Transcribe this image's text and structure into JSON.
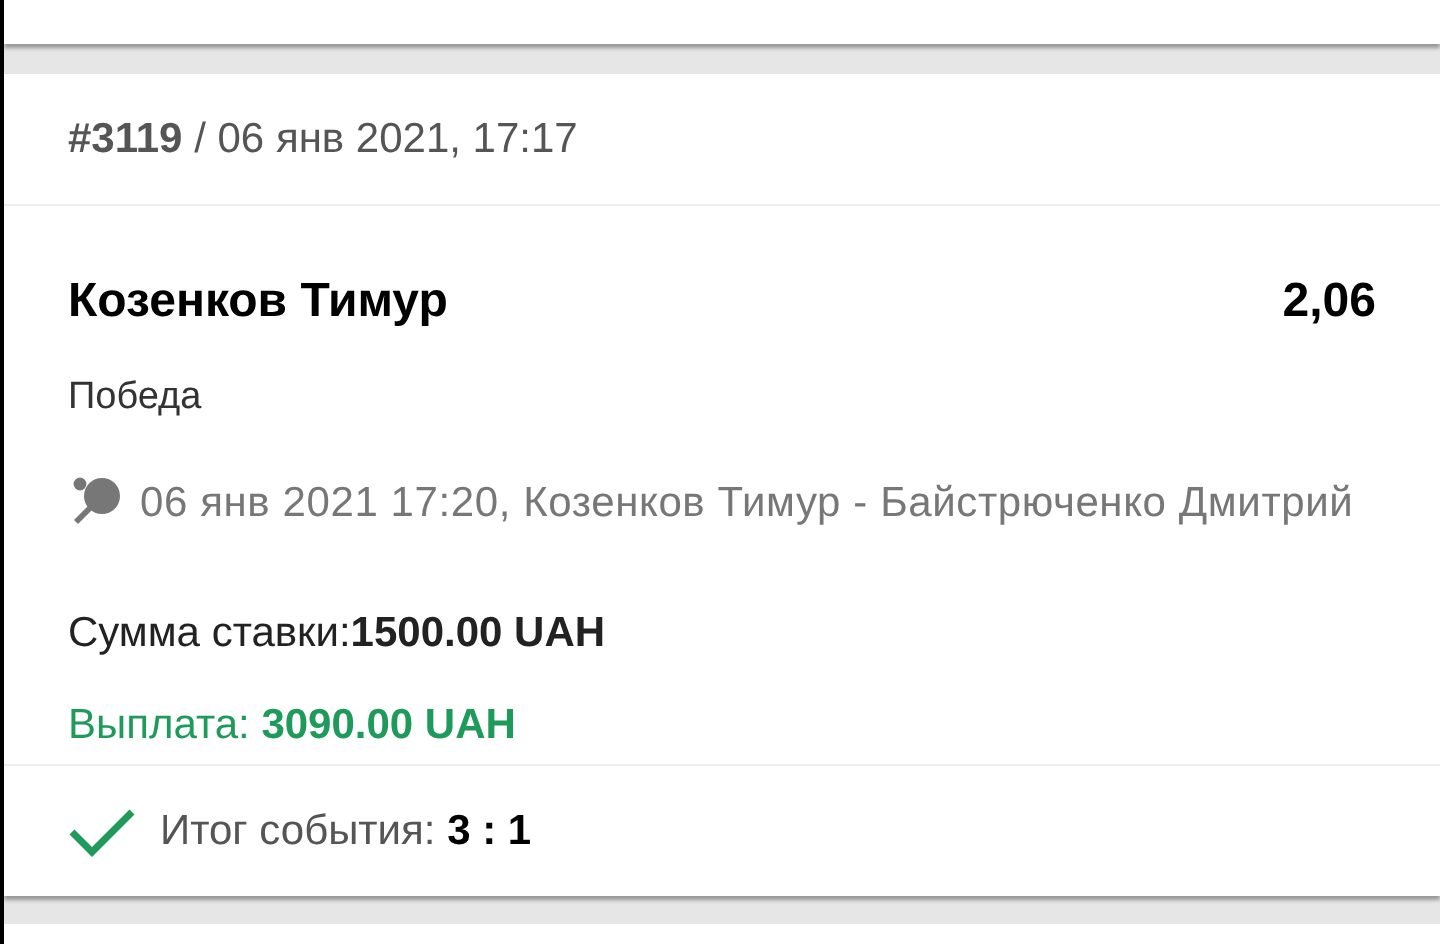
{
  "bet": {
    "header": "**#3119** / 06 янв 2021, 17:17",
    "selection": {
      "player": "Козенков Тимур",
      "odds": "2,06",
      "market": "Победа",
      "event": "06 янв 2021 17:20, Козенков Тимур - Байстрюченко Дмитрий"
    },
    "stake": "Сумма ставки:**1500.00 UAH**",
    "payout": "Выплата: **3090.00 UAH**",
    "result": {
      "won": true,
      "text": "Итог события: **3 : 1**"
    }
  }
}
